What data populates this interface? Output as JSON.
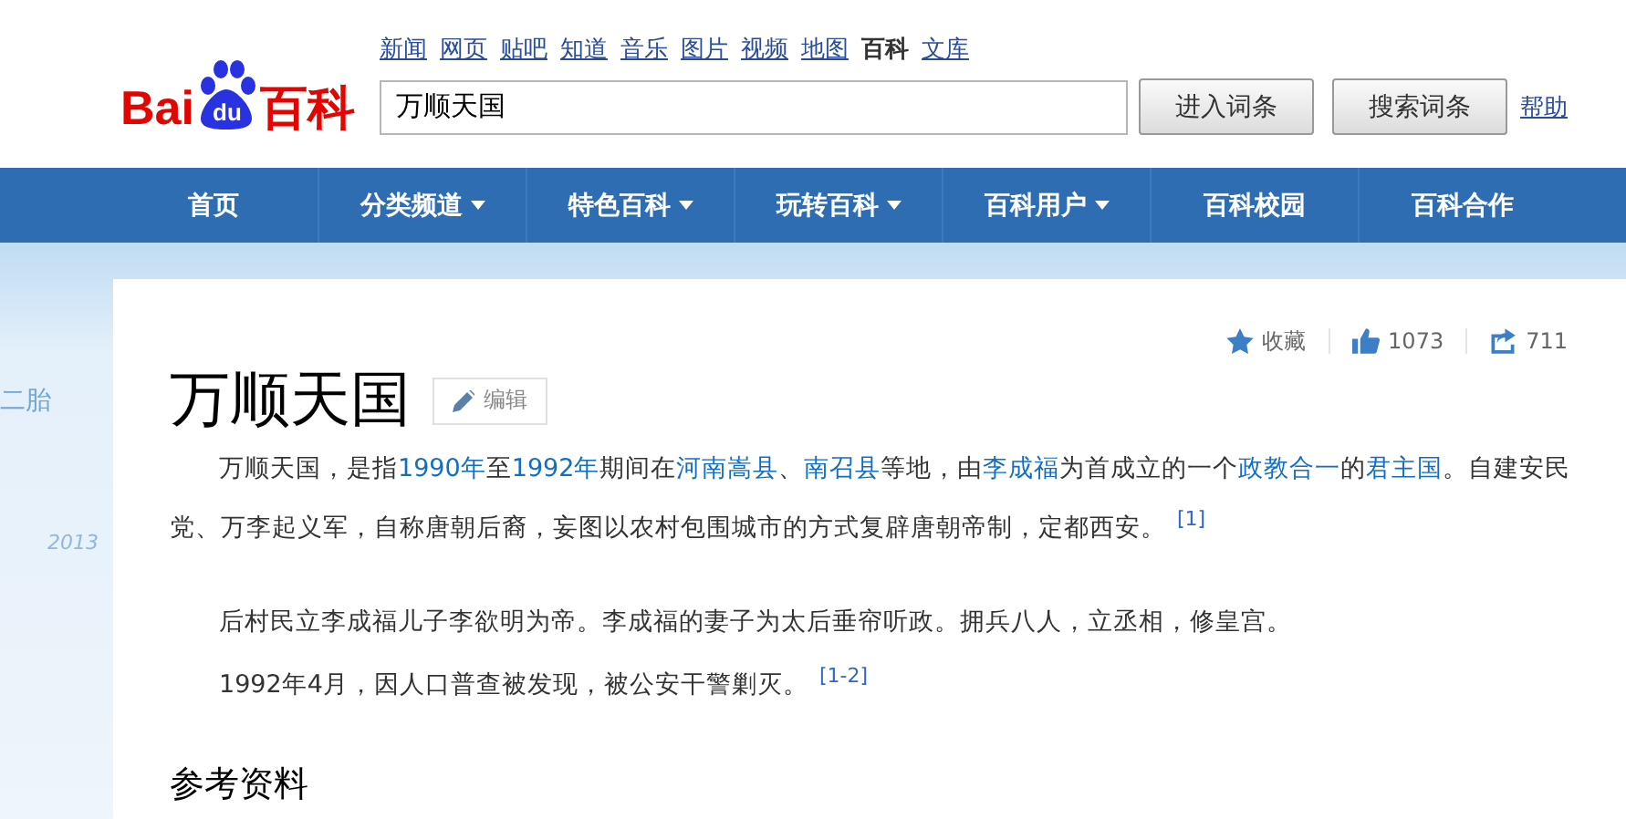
{
  "logo": {
    "part_1": "Bai",
    "part_2": "du",
    "part_3": "百科"
  },
  "top_links": [
    {
      "label": "新闻",
      "selected": false
    },
    {
      "label": "网页",
      "selected": false
    },
    {
      "label": "贴吧",
      "selected": false
    },
    {
      "label": "知道",
      "selected": false
    },
    {
      "label": "音乐",
      "selected": false
    },
    {
      "label": "图片",
      "selected": false
    },
    {
      "label": "视频",
      "selected": false
    },
    {
      "label": "地图",
      "selected": false
    },
    {
      "label": "百科",
      "selected": true
    },
    {
      "label": "文库",
      "selected": false
    }
  ],
  "search": {
    "value": "万顺天国"
  },
  "buttons": [
    "进入词条",
    "搜索词条"
  ],
  "help_link": "帮助",
  "nav": [
    {
      "label": "首页",
      "dropdown": false
    },
    {
      "label": "分类频道",
      "dropdown": true
    },
    {
      "label": "特色百科",
      "dropdown": true
    },
    {
      "label": "玩转百科",
      "dropdown": true
    },
    {
      "label": "百科用户",
      "dropdown": true
    },
    {
      "label": "百科校园",
      "dropdown": false
    },
    {
      "label": "百科合作",
      "dropdown": false
    }
  ],
  "banner": {
    "texts": [
      "二胎",
      "2013"
    ]
  },
  "article": {
    "title": "万顺天国",
    "edit_button": "编辑",
    "actions": [
      {
        "kind": "star",
        "label": "收藏"
      },
      {
        "kind": "like",
        "label": "1073"
      },
      {
        "kind": "share",
        "label": "711"
      }
    ],
    "paragraphs": [
      {
        "segments": [
          {
            "text": "万顺天国，是指",
            "link": false
          },
          {
            "text": "1990年",
            "link": true
          },
          {
            "text": "至",
            "link": false
          },
          {
            "text": "1992年",
            "link": true
          },
          {
            "text": "期间在",
            "link": false
          },
          {
            "text": "河南嵩县",
            "link": true
          },
          {
            "text": "、",
            "link": false
          },
          {
            "text": "南召县",
            "link": true
          },
          {
            "text": "等地，由",
            "link": false
          },
          {
            "text": "李成福",
            "link": true
          },
          {
            "text": "为首成立的一个",
            "link": false
          },
          {
            "text": "政教合一",
            "link": true
          },
          {
            "text": "的",
            "link": false
          },
          {
            "text": "君主国",
            "link": true
          },
          {
            "text": "。自建安民党、万李起义军，自称唐朝后裔，妄图以农村包围城市的方式复辟唐朝帝制，定都西安。",
            "link": false
          }
        ],
        "ref": "[1]"
      },
      {
        "segments": [
          {
            "text": "后村民立李成福儿子李欲明为帝。李成福的妻子为太后垂帘听政。拥兵八人，立丞相，修皇宫。",
            "link": false
          }
        ]
      },
      {
        "segments": [
          {
            "text": "1992年4月，因人口普查被发现，被公安干警剿灭。",
            "link": false
          }
        ],
        "ref": "[1-2]"
      }
    ],
    "section_heading": "参考资料"
  }
}
